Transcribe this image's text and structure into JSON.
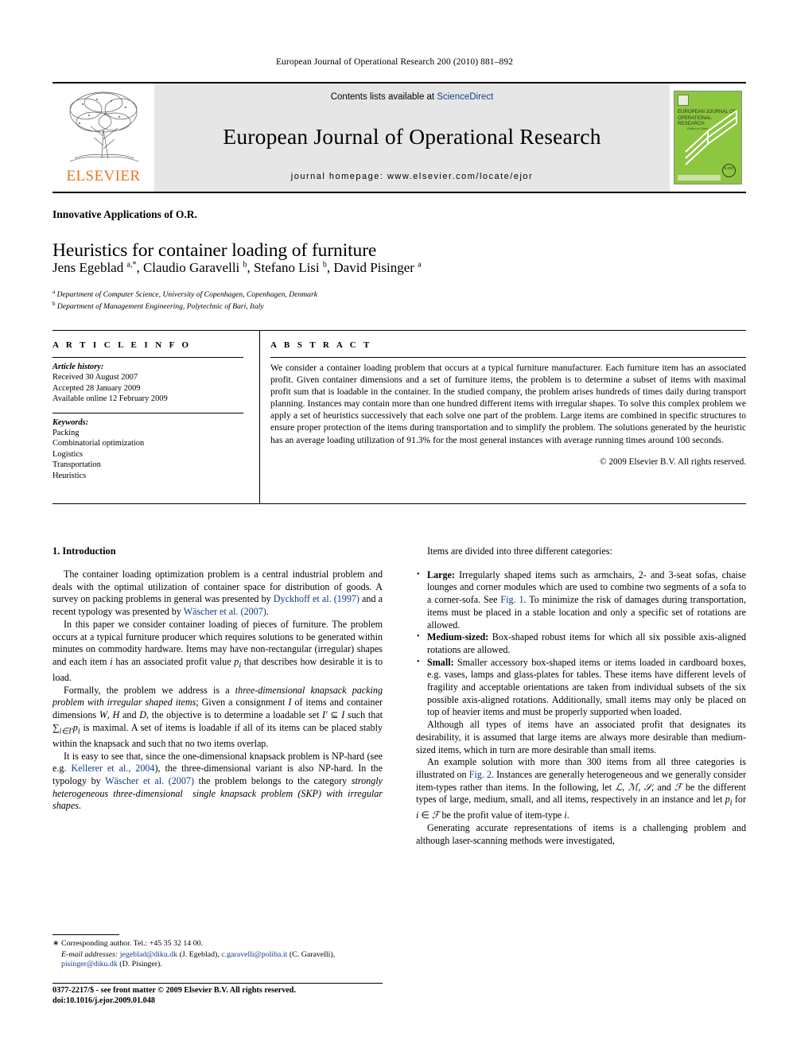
{
  "running_head": "European Journal of Operational Research 200 (2010) 881–892",
  "masthead": {
    "contents_prefix": "Contents lists available at ",
    "sciencedirect": "ScienceDirect",
    "journal_title": "European Journal of Operational Research",
    "homepage": "journal homepage: www.elsevier.com/locate/ejor",
    "publisher": "ELSEVIER",
    "cover": {
      "title": "EUROPEAN JOURNAL OF OPERATIONAL RESEARCH",
      "subtitle": "Editor-in-Chief",
      "emblem_text": "EJOR",
      "green": "#8dc63f"
    },
    "accent_orange": "#e87722",
    "link_blue": "#1a3e8c",
    "band_gray": "#e6e6e6"
  },
  "article": {
    "section_label": "Innovative Applications of O.R.",
    "title": "Heuristics for container loading of furniture",
    "authors_html": "Jens Egeblad <sup>a,</sup><sup>*</sup>, Claudio Garavelli <sup>b</sup>, Stefano Lisi <sup>b</sup>, David Pisinger <sup>a</sup>",
    "affiliation_a": "Department of Computer Science, University of Copenhagen, Copenhagen, Denmark",
    "affiliation_b": "Department of Management Engineering, Polytechnic of Bari, Italy"
  },
  "info": {
    "heading": "A R T I C L E   I N F O",
    "history_label": "Article history:",
    "history": [
      "Received 30 August 2007",
      "Accepted 28 January 2009",
      "Available online 12 February 2009"
    ],
    "keywords_label": "Keywords:",
    "keywords": [
      "Packing",
      "Combinatorial optimization",
      "Logistics",
      "Transportation",
      "Heuristics"
    ]
  },
  "abstract": {
    "heading": "A B S T R A C T",
    "text": "We consider a container loading problem that occurs at a typical furniture manufacturer. Each furniture item has an associated profit. Given container dimensions and a set of furniture items, the problem is to determine a subset of items with maximal profit sum that is loadable in the container. In the studied company, the problem arises hundreds of times daily during transport planning. Instances may contain more than one hundred different items with irregular shapes. To solve this complex problem we apply a set of heuristics successively that each solve one part of the problem. Large items are combined in specific structures to ensure proper protection of the items during transportation and to simplify the problem. The solutions generated by the heuristic has an average loading utilization of 91.3% for the most general instances with average running times around 100 seconds.",
    "copyright": "© 2009 Elsevier B.V. All rights reserved."
  },
  "body": {
    "intro_heading": "1. Introduction",
    "left_paragraphs": [
      "The container loading optimization problem is a central industrial problem and deals with the optimal utilization of container space for distribution of goods. A survey on packing problems in general was presented by <span class=\"ref-link\">Dyckhoff et al. (1997)</span> and a recent typology was presented by <span class=\"ref-link\">Wäscher et al. (2007)</span>.",
      "In this paper we consider container loading of pieces of furniture. The problem occurs at a typical furniture producer which requires solutions to be generated within minutes on commodity hardware. Items may have non-rectangular (irregular) shapes and each item <span class=\"it\">i</span> has an associated profit value <span class=\"it\">p<sub>i</sub></span> that describes how desirable it is to load.",
      "Formally, the problem we address is a <span class=\"it\">three-dimensional knapsack packing problem with irregular shaped items</span>; Given a consignment <span class=\"it\">I</span> of items and container dimensions <span class=\"it\">W</span>, <span class=\"it\">H</span> and <span class=\"it\">D</span>, the objective is to determine a loadable set <span class=\"it\">I&prime;</span> &sube; <span class=\"it\">I</span> such that &sum;<sub><span class=\"it\">i&isin;I&prime;</span></sub><span class=\"it\">p<sub>i</sub></span> is maximal. A set of items is loadable if all of its items can be placed stably within the knapsack and such that no two items overlap.",
      "It is easy to see that, since the one-dimensional knapsack problem is NP-hard (see e.g. <span class=\"ref-link\">Kellerer et al., 2004</span>), the three-dimensional variant is also NP-hard. In the typology by <span class=\"ref-link\">Wäscher et al. (2007)</span> the problem belongs to the category <span class=\"it\">strongly heterogeneous three-dimensional &nbsp;single knapsack problem (SKP) with irregular shapes</span>."
    ],
    "right_intro": "Items are divided into three different categories:",
    "categories": [
      "<span class=\"bd\">Large:</span> Irregularly shaped items such as armchairs, 2- and 3-seat sofas, chaise lounges and corner modules which are used to combine two segments of a sofa to a corner-sofa. See <span class=\"ref-link\">Fig. 1</span>. To minimize the risk of damages during transportation, items must be placed in a stable location and only a specific set of rotations are allowed.",
      "<span class=\"bd\">Medium-sized:</span> Box-shaped robust items for which all six possible axis-aligned rotations are allowed.",
      "<span class=\"bd\">Small:</span> Smaller accessory box-shaped items or items loaded in cardboard boxes, e.g. vases, lamps and glass-plates for tables. These items have different levels of fragility and acceptable orientations are taken from individual subsets of the six possible axis-aligned rotations. Additionally, small items may only be placed on top of heavier items and must be properly supported when loaded."
    ],
    "right_paragraphs": [
      "Although all types of items have an associated profit that designates its desirability, it is assumed that large items are always more desirable than medium-sized items, which in turn are more desirable than small items.",
      "An example solution with more than 300 items from all three categories is illustrated on <span class=\"ref-link\">Fig. 2</span>. Instances are generally heterogeneous and we generally consider item-types rather than items. In the following, let <span class=\"it\">&#8466;</span>, <span class=\"it\">&#8499;</span>, <span class=\"it\">&#119982;</span>, and <span class=\"it\">&#8497;</span> be the different types of large, medium, small, and all items, respectively in an instance and let <span class=\"it\">p<sub>i</sub></span> for <span class=\"it\">i</span> &isin; <span class=\"it\">&#8497;</span> be the profit value of item-type <span class=\"it\">i</span>.",
      "Generating accurate representations of items is a challenging problem and although laser-scanning methods were investigated,"
    ]
  },
  "footnotes": {
    "corresponding": "Corresponding author. Tel.: +45 35 32 14 00.",
    "email_label": "E-mail addresses:",
    "emails_html": " <span class=\"mail\">jegeblad@diku.dk</span> (J. Egeblad), <span class=\"mail\">c.garavelli@poliba.it</span> (C. Garavelli), <span class=\"mail\">pisinger@diku.dk</span> (D. Pisinger)."
  },
  "imprint": {
    "line1": "0377-2217/$ - see front matter © 2009 Elsevier B.V. All rights reserved.",
    "line2": "doi:10.1016/j.ejor.2009.01.048"
  }
}
